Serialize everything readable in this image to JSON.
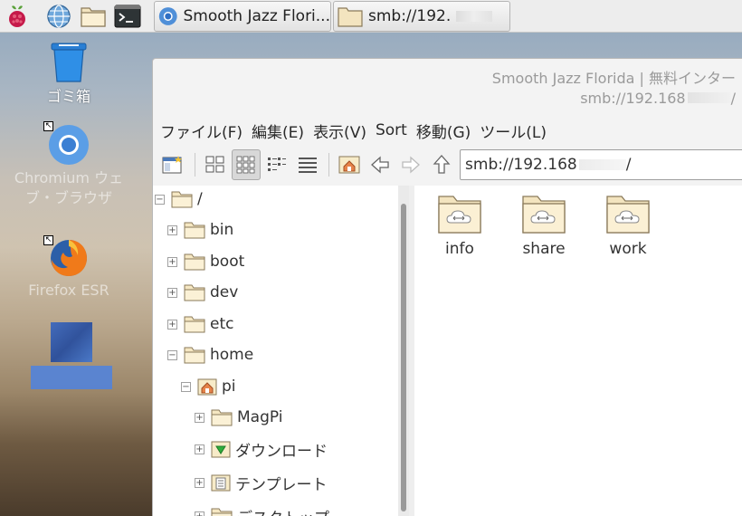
{
  "panel": {
    "tasks": [
      {
        "label": "Smooth Jazz Flori..."
      },
      {
        "label": "smb://192."
      }
    ]
  },
  "desktop": {
    "icons": [
      {
        "label": "ゴミ箱"
      },
      {
        "label_line1": "Chromium ウェ",
        "label_line2": "ブ・ブラウザ"
      },
      {
        "label": "Firefox ESR"
      }
    ]
  },
  "window": {
    "title_line1": "Smooth Jazz Florida | 無料インター",
    "title_line2": "smb://192.168",
    "title_line2_suffix": "/",
    "menu": [
      "ファイル(F)",
      "編集(E)",
      "表示(V)",
      "Sort",
      "移動(G)",
      "ツール(L)"
    ],
    "address": {
      "value": "smb://192.168",
      "suffix": "/"
    },
    "tree": [
      {
        "label": "/",
        "level": 0,
        "expanded": true
      },
      {
        "label": "bin",
        "level": 1,
        "expanded": false
      },
      {
        "label": "boot",
        "level": 1,
        "expanded": false
      },
      {
        "label": "dev",
        "level": 1,
        "expanded": false
      },
      {
        "label": "etc",
        "level": 1,
        "expanded": false
      },
      {
        "label": "home",
        "level": 1,
        "expanded": true
      },
      {
        "label": "pi",
        "level": 2,
        "expanded": true
      },
      {
        "label": "MagPi",
        "level": 3,
        "expanded": false
      },
      {
        "label": "ダウンロード",
        "level": 3,
        "expanded": false
      },
      {
        "label": "テンプレート",
        "level": 3,
        "expanded": false
      },
      {
        "label": "デスクトップ",
        "level": 3,
        "expanded": false
      }
    ],
    "files": [
      {
        "name": "info"
      },
      {
        "name": "share"
      },
      {
        "name": "work"
      }
    ]
  }
}
